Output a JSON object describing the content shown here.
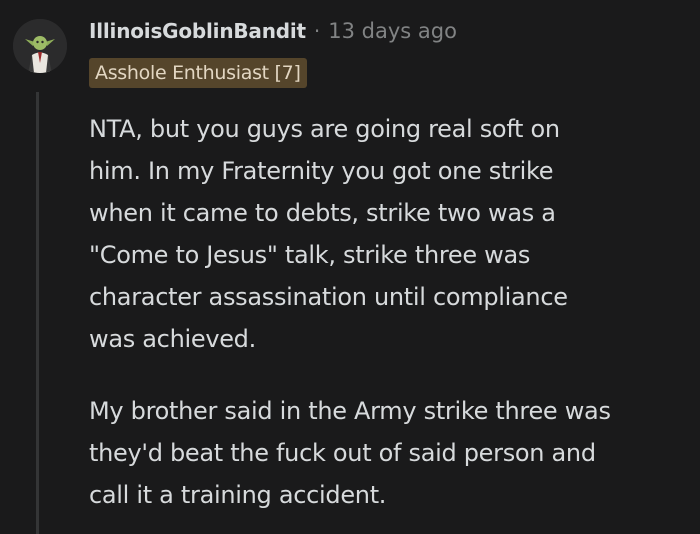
{
  "comment": {
    "author": "IllinoisGoblinBandit",
    "separator": "·",
    "timestamp": "13 days ago",
    "flair": "Asshole Enthusiast [7]",
    "avatar_icon": "avatar-icon",
    "paragraphs": [
      {
        "lines": [
          "NTA, but you guys are going real soft on",
          "him. In my Fraternity you got one strike",
          "when it came to debts, strike two was a",
          "\"Come to Jesus\" talk, strike three was",
          "character assassination until compliance",
          "was achieved."
        ]
      },
      {
        "lines": [
          "My brother said in the Army strike three was",
          "they'd beat the fuck out of said person and",
          "call it a training accident."
        ]
      }
    ]
  },
  "colors": {
    "background": "#1a1a1b",
    "text": "#d7dadc",
    "meta": "#818384",
    "flair_bg": "#55452b",
    "thread_line": "#343536"
  }
}
